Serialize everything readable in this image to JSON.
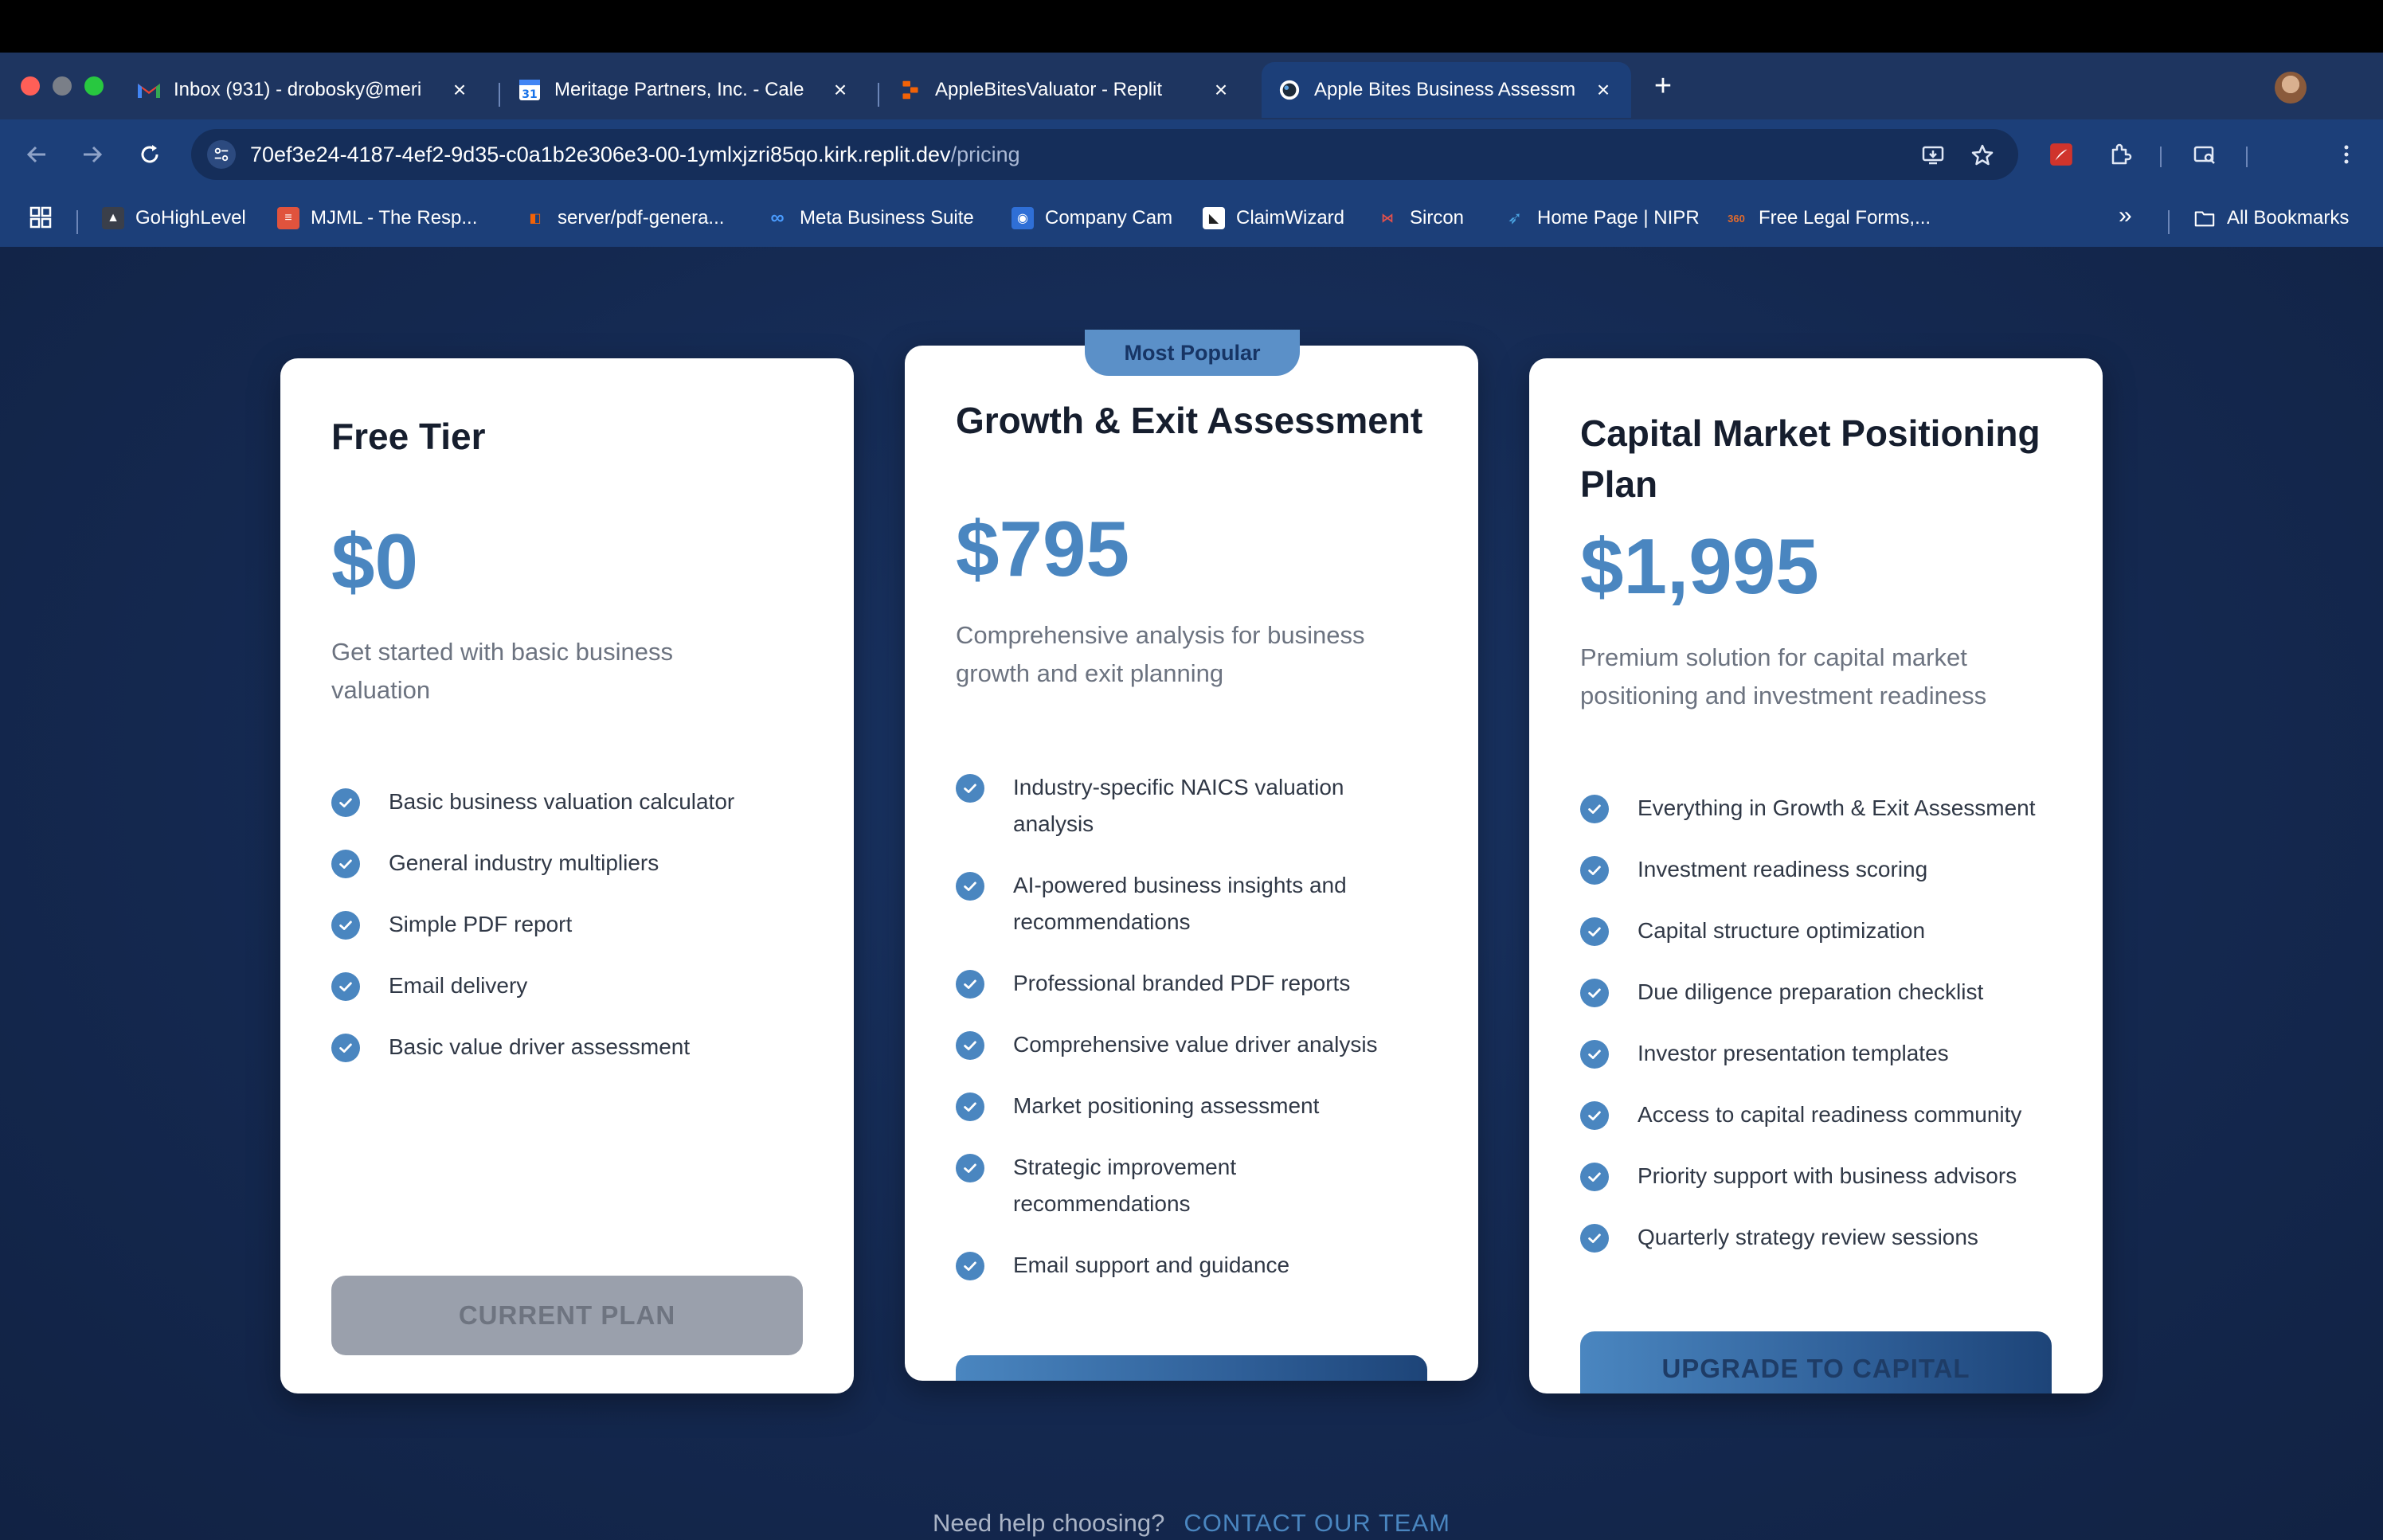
{
  "browser": {
    "tabs": [
      {
        "title": "Inbox (931) - drobosky@meri",
        "icon": "gmail-icon"
      },
      {
        "title": "Meritage Partners, Inc. - Cale",
        "icon": "calendar-icon"
      },
      {
        "title": "AppleBitesValuator - Replit",
        "icon": "replit-icon"
      },
      {
        "title": "Apple Bites Business Assessm",
        "icon": "globe-icon"
      }
    ],
    "url_host": "70ef3e24-4187-4ef2-9d35-c0a1b2e306e3-00-1ymlxjzri85qo.kirk.replit.dev",
    "url_path": "/pricing",
    "bookmarks": [
      {
        "label": "GoHighLevel",
        "color": "#3a3f4a"
      },
      {
        "label": "MJML - The Resp...",
        "color": "#e0533d"
      },
      {
        "label": "server/pdf-genera...",
        "color": "#f26207"
      },
      {
        "label": "Meta Business Suite",
        "color": "#1877f2"
      },
      {
        "label": "Company Cam",
        "color": "#2f6fd6"
      },
      {
        "label": "ClaimWizard",
        "color": "#ffffff"
      },
      {
        "label": "Sircon",
        "color": "#e2504c"
      },
      {
        "label": "Home Page | NIPR",
        "color": "#4aa3e0"
      },
      {
        "label": "Free Legal Forms,...",
        "color": "#e06a2c"
      }
    ],
    "all_bookmarks": "All Bookmarks",
    "overflow": "»"
  },
  "pricing": {
    "badge": "Most Popular",
    "plans": [
      {
        "title": "Free Tier",
        "price": "$0",
        "description": "Get started with basic business valuation",
        "features": [
          "Basic business valuation calculator",
          "General industry multipliers",
          "Simple PDF report",
          "Email delivery",
          "Basic value driver assessment"
        ],
        "button": "CURRENT PLAN"
      },
      {
        "title": "Growth & Exit Assessment",
        "price": "$795",
        "description": "Comprehensive analysis for business growth and exit planning",
        "features": [
          "Industry-specific NAICS valuation analysis",
          "AI-powered business insights and recommendations",
          "Professional branded PDF reports",
          "Comprehensive value driver analysis",
          "Market positioning assessment",
          "Strategic improvement recommendations",
          "Email support and guidance"
        ],
        "button": ""
      },
      {
        "title": "Capital Market Positioning Plan",
        "price": "$1,995",
        "description": "Premium solution for capital market positioning and investment readiness",
        "features": [
          "Everything in Growth & Exit Assessment",
          "Investment readiness scoring",
          "Capital structure optimization",
          "Due diligence preparation checklist",
          "Investor presentation templates",
          "Access to capital readiness community",
          "Priority support with business advisors",
          "Quarterly strategy review sessions"
        ],
        "button": "UPGRADE TO CAPITAL"
      }
    ],
    "help_question": "Need help choosing?",
    "help_link": "CONTACT OUR TEAM"
  }
}
